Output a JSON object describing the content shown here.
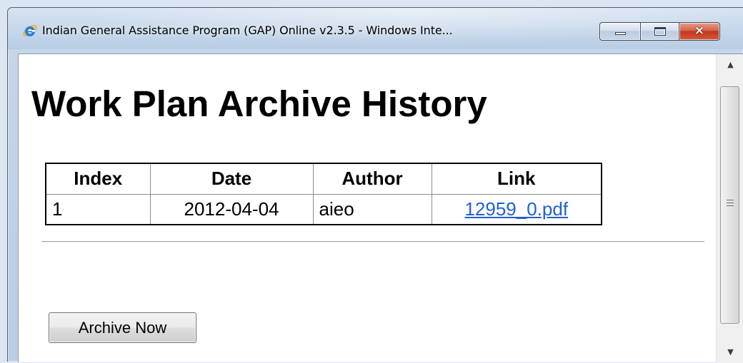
{
  "window": {
    "title": "Indian General Assistance Program (GAP) Online v2.3.5 - Windows Inte...",
    "icon": "internet-explorer-icon",
    "buttons": {
      "minimize": "minimize-icon",
      "maximize": "maximize-icon",
      "close": "×"
    }
  },
  "page": {
    "heading": "Work Plan Archive History",
    "table": {
      "columns": [
        "Index",
        "Date",
        "Author",
        "Link"
      ],
      "rows": [
        {
          "index": "1",
          "date": "2012-04-04",
          "author": "aieo",
          "link": "12959_0.pdf"
        }
      ]
    },
    "archive_button": "Archive Now"
  },
  "scrollbar": {
    "up": "▲",
    "down": "▼"
  },
  "colors": {
    "link": "#1f5fd6",
    "close_button": "#c2381d",
    "titlebar": "#c7d7ea"
  }
}
